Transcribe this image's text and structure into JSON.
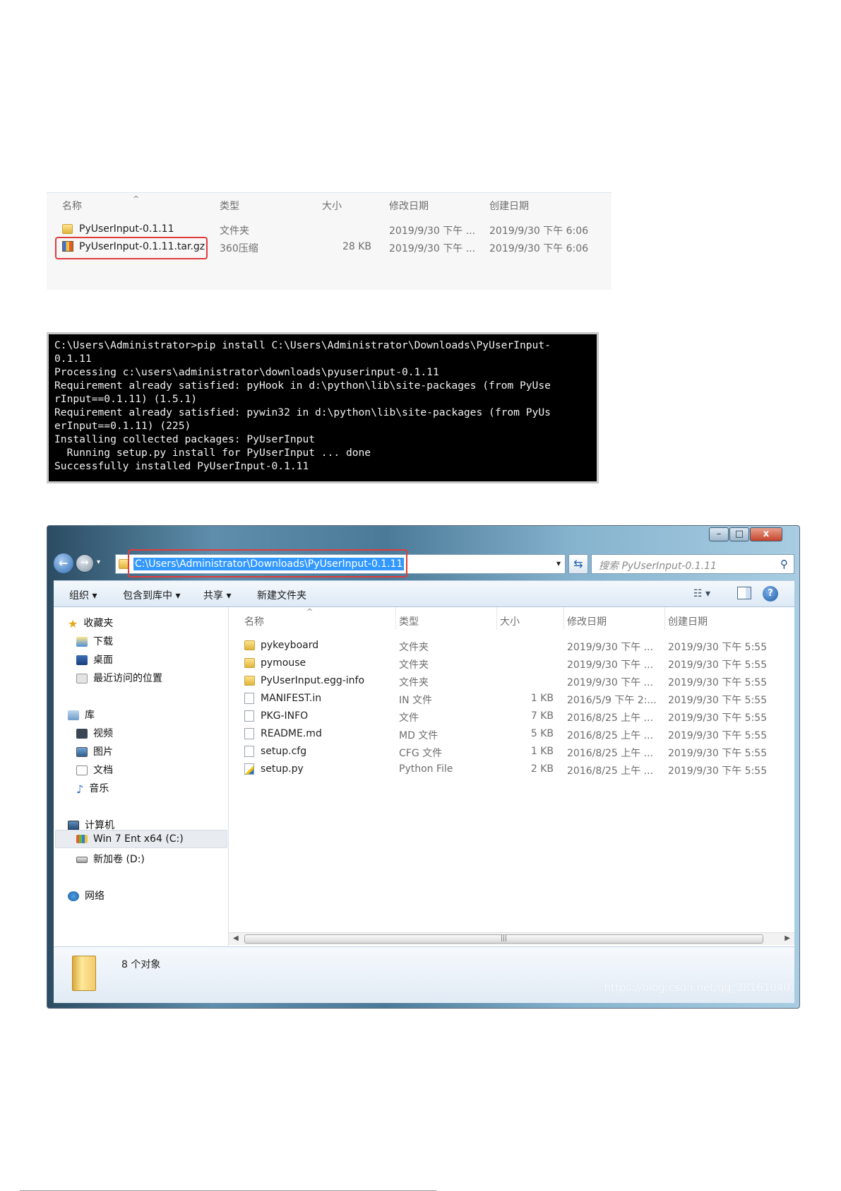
{
  "explorer_top": {
    "columns": [
      "名称",
      "类型",
      "大小",
      "修改日期",
      "创建日期"
    ],
    "rows": [
      {
        "icon": "folder-icon",
        "name": "PyUserInput-0.1.11",
        "type": "文件夹",
        "size": "",
        "modified": "2019/9/30 下午 ...",
        "created": "2019/9/30 下午 6:06"
      },
      {
        "icon": "archive-icon",
        "name": "PyUserInput-0.1.11.tar.gz",
        "type": "360压缩",
        "size": "28 KB",
        "modified": "2019/9/30 下午 ...",
        "created": "2019/9/30 下午 6:06"
      }
    ]
  },
  "terminal": {
    "lines": [
      "C:\\Users\\Administrator>pip install C:\\Users\\Administrator\\Downloads\\PyUserInput-",
      "0.1.11",
      "Processing c:\\users\\administrator\\downloads\\pyuserinput-0.1.11",
      "Requirement already satisfied: pyHook in d:\\python\\lib\\site-packages (from PyUse",
      "rInput==0.1.11) (1.5.1)",
      "Requirement already satisfied: pywin32 in d:\\python\\lib\\site-packages (from PyUs",
      "erInput==0.1.11) (225)",
      "Installing collected packages: PyUserInput",
      "  Running setup.py install for PyUserInput ... done",
      "Successfully installed PyUserInput-0.1.11"
    ]
  },
  "explorer": {
    "window_buttons": {
      "minimize": "–",
      "maximize": "□",
      "close": "x"
    },
    "address": "C:\\Users\\Administrator\\Downloads\\PyUserInput-0.1.11",
    "search_placeholder": "搜索 PyUserInput-0.1.11",
    "toolbar": {
      "organize": "组织 ▾",
      "include_library": "包含到库中 ▾",
      "share": "共享 ▾",
      "new_folder": "新建文件夹"
    },
    "nav": {
      "favorites": "收藏夹",
      "downloads": "下载",
      "desktop": "桌面",
      "recent": "最近访问的位置",
      "libraries": "库",
      "videos": "视频",
      "pictures": "图片",
      "documents": "文档",
      "music": "音乐",
      "computer": "计算机",
      "drive_c": "Win 7 Ent x64 (C:)",
      "drive_d": "新加卷 (D:)",
      "network": "网络"
    },
    "columns": [
      "名称",
      "类型",
      "大小",
      "修改日期",
      "创建日期"
    ],
    "rows": [
      {
        "icon": "folder-icon",
        "name": "pykeyboard",
        "type": "文件夹",
        "size": "",
        "modified": "2019/9/30 下午 ...",
        "created": "2019/9/30 下午 5:55"
      },
      {
        "icon": "folder-icon",
        "name": "pymouse",
        "type": "文件夹",
        "size": "",
        "modified": "2019/9/30 下午 ...",
        "created": "2019/9/30 下午 5:55"
      },
      {
        "icon": "folder-icon",
        "name": "PyUserInput.egg-info",
        "type": "文件夹",
        "size": "",
        "modified": "2019/9/30 下午 ...",
        "created": "2019/9/30 下午 5:55"
      },
      {
        "icon": "file-icon",
        "name": "MANIFEST.in",
        "type": "IN 文件",
        "size": "1 KB",
        "modified": "2016/5/9 下午 2:...",
        "created": "2019/9/30 下午 5:55"
      },
      {
        "icon": "file-icon",
        "name": "PKG-INFO",
        "type": "文件",
        "size": "7 KB",
        "modified": "2016/8/25 上午 ...",
        "created": "2019/9/30 下午 5:55"
      },
      {
        "icon": "file-icon",
        "name": "README.md",
        "type": "MD 文件",
        "size": "5 KB",
        "modified": "2016/8/25 上午 ...",
        "created": "2019/9/30 下午 5:55"
      },
      {
        "icon": "file-icon",
        "name": "setup.cfg",
        "type": "CFG 文件",
        "size": "1 KB",
        "modified": "2016/8/25 上午 ...",
        "created": "2019/9/30 下午 5:55"
      },
      {
        "icon": "python-file-icon",
        "name": "setup.py",
        "type": "Python File",
        "size": "2 KB",
        "modified": "2016/8/25 上午 ...",
        "created": "2019/9/30 下午 5:55"
      }
    ],
    "status_count": "8 个对象",
    "watermark": "https://blog.csdn.net/qq_38161040"
  },
  "colors": {
    "highlight_red": "#e23b3b",
    "selection_blue": "#3399ff"
  }
}
